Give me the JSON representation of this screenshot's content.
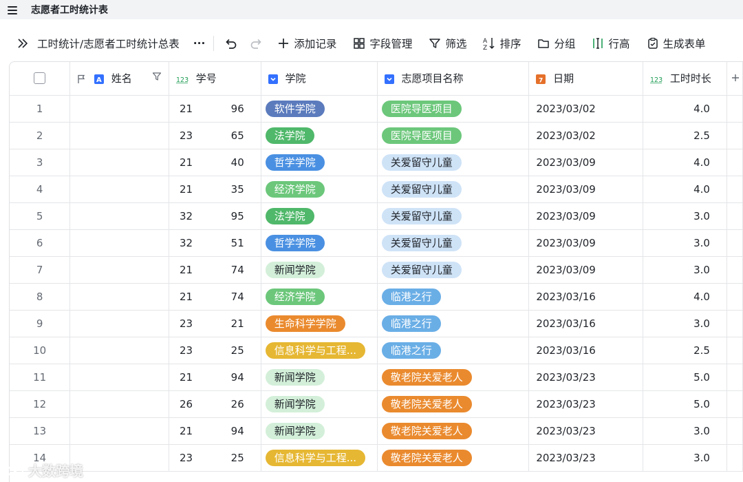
{
  "app": {
    "title": "志愿者工时统计表"
  },
  "toolbar": {
    "breadcrumb": "工时统计/志愿者工时统计总表",
    "more": "···",
    "add_record": "添加记录",
    "field_manage": "字段管理",
    "filter": "筛选",
    "sort": "排序",
    "group": "分组",
    "row_height": "行高",
    "generate_form": "生成表单"
  },
  "table": {
    "headers": {
      "name": "姓名",
      "student_id": "学号",
      "college": "学院",
      "project": "志愿项目名称",
      "date": "日期",
      "hours": "工时时长"
    },
    "rows": [
      {
        "idx": "1",
        "sid_a": "21",
        "sid_b": "96",
        "college": "软件学院",
        "project": "医院导医项目",
        "date": "2023/03/02",
        "hours": "4.0",
        "ctag": "slate",
        "ptag": "lightgreen"
      },
      {
        "idx": "2",
        "sid_a": "23",
        "sid_b": "65",
        "college": "法学院",
        "project": "医院导医项目",
        "date": "2023/03/02",
        "hours": "2.5",
        "ctag": "green",
        "ptag": "lightgreen"
      },
      {
        "idx": "3",
        "sid_a": "21",
        "sid_b": "40",
        "college": "哲学学院",
        "project": "关爱留守儿童",
        "date": "2023/03/09",
        "hours": "4.0",
        "ctag": "blue",
        "ptag": "paleblue"
      },
      {
        "idx": "4",
        "sid_a": "21",
        "sid_b": "35",
        "college": "经济学院",
        "project": "关爱留守儿童",
        "date": "2023/03/09",
        "hours": "4.0",
        "ctag": "lightgreen",
        "ptag": "paleblue"
      },
      {
        "idx": "5",
        "sid_a": "32",
        "sid_b": "95",
        "college": "法学院",
        "project": "关爱留守儿童",
        "date": "2023/03/09",
        "hours": "3.0",
        "ctag": "green",
        "ptag": "paleblue"
      },
      {
        "idx": "6",
        "sid_a": "32",
        "sid_b": "51",
        "college": "哲学学院",
        "project": "关爱留守儿童",
        "date": "2023/03/09",
        "hours": "3.0",
        "ctag": "blue",
        "ptag": "paleblue"
      },
      {
        "idx": "7",
        "sid_a": "21",
        "sid_b": "74",
        "college": "新闻学院",
        "project": "关爱留守儿童",
        "date": "2023/03/09",
        "hours": "3.0",
        "ctag": "palegreen",
        "ptag": "paleblue"
      },
      {
        "idx": "8",
        "sid_a": "21",
        "sid_b": "74",
        "college": "经济学院",
        "project": "临港之行",
        "date": "2023/03/16",
        "hours": "4.0",
        "ctag": "lightgreen",
        "ptag": "skyblue"
      },
      {
        "idx": "9",
        "sid_a": "23",
        "sid_b": "21",
        "college": "生命科学学院",
        "project": "临港之行",
        "date": "2023/03/16",
        "hours": "3.0",
        "ctag": "orange",
        "ptag": "skyblue"
      },
      {
        "idx": "10",
        "sid_a": "23",
        "sid_b": "25",
        "college": "信息科学与工程...",
        "project": "临港之行",
        "date": "2023/03/16",
        "hours": "2.5",
        "ctag": "yellow",
        "ptag": "skyblue"
      },
      {
        "idx": "11",
        "sid_a": "21",
        "sid_b": "94",
        "college": "新闻学院",
        "project": "敬老院关爱老人",
        "date": "2023/03/23",
        "hours": "5.0",
        "ctag": "palegreen",
        "ptag": "orange"
      },
      {
        "idx": "12",
        "sid_a": "26",
        "sid_b": "26",
        "college": "新闻学院",
        "project": "敬老院关爱老人",
        "date": "2023/03/23",
        "hours": "5.0",
        "ctag": "palegreen",
        "ptag": "orange"
      },
      {
        "idx": "13",
        "sid_a": "21",
        "sid_b": "94",
        "college": "新闻学院",
        "project": "敬老院关爱老人",
        "date": "2023/03/23",
        "hours": "3.0",
        "ctag": "palegreen",
        "ptag": "orange"
      },
      {
        "idx": "14",
        "sid_a": "23",
        "sid_b": "25",
        "college": "信息科学与工程...",
        "project": "敬老院关爱老人",
        "date": "2023/03/23",
        "hours": "3.0",
        "ctag": "yellow",
        "ptag": "orange"
      }
    ]
  },
  "tag_colors": {
    "slate": {
      "bg": "#5b7bbd",
      "fg": "#ffffff"
    },
    "green": {
      "bg": "#4fb86a",
      "fg": "#ffffff"
    },
    "blue": {
      "bg": "#4a90e2",
      "fg": "#ffffff"
    },
    "lightgreen": {
      "bg": "#6cc77b",
      "fg": "#ffffff"
    },
    "palegreen": {
      "bg": "#d3efd9",
      "fg": "#1f2329"
    },
    "orange": {
      "bg": "#ea8a2e",
      "fg": "#ffffff"
    },
    "yellow": {
      "bg": "#e6b733",
      "fg": "#ffffff"
    },
    "paleblue": {
      "bg": "#cfe3f7",
      "fg": "#1f2329"
    },
    "skyblue": {
      "bg": "#6aaee6",
      "fg": "#ffffff"
    }
  },
  "watermark": "大数跨境"
}
